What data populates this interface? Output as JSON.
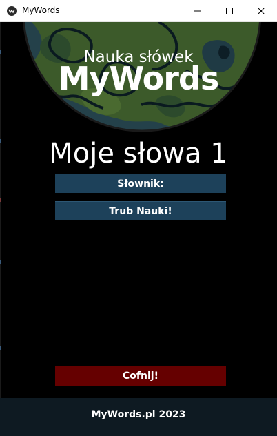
{
  "window": {
    "title": "MyWords",
    "icon": "app-logo-icon",
    "controls": [
      "minimize-icon",
      "maximize-icon",
      "close-icon"
    ]
  },
  "hero": {
    "subtitle": "Nauka słówek",
    "title": "MyWords",
    "image": "globe-map"
  },
  "page": {
    "heading": "Moje słowa 1"
  },
  "buttons": {
    "dictionary": "Słownik:",
    "learning_mode": "Trub Nauki!",
    "back": "Cofnij!"
  },
  "footer": {
    "text": "MyWords.pl 2023"
  },
  "colors": {
    "background": "#000000",
    "button_blue": "#1d415a",
    "button_red": "#650000",
    "footer_bg": "#0e1a22",
    "text": "#ffffff"
  }
}
